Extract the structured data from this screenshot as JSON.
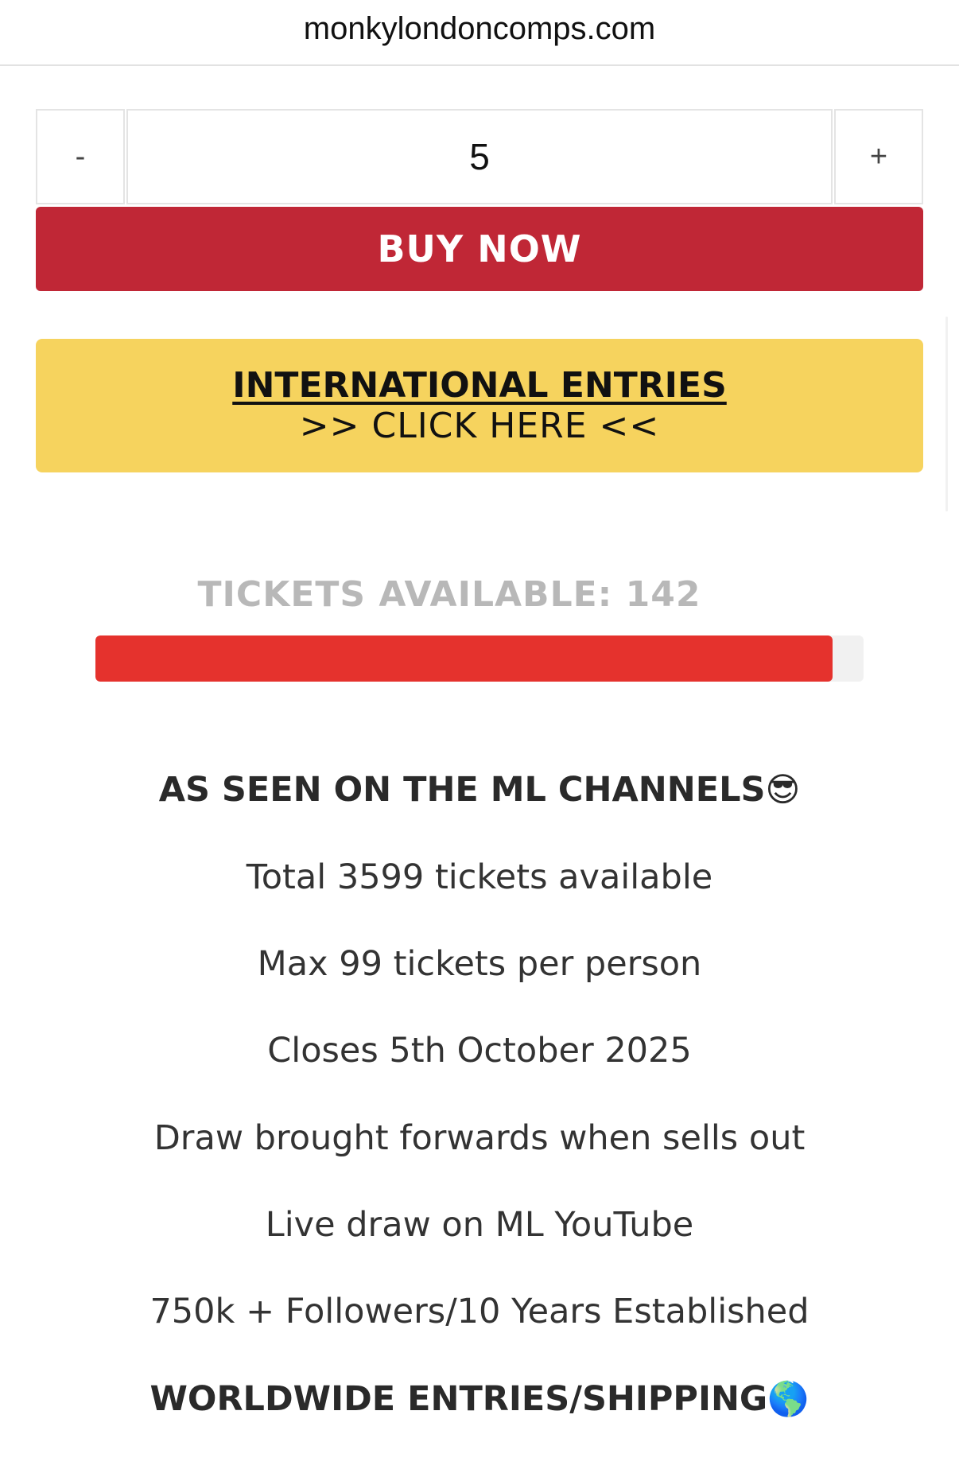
{
  "browser": {
    "url": "monkylondoncomps.com"
  },
  "stepper": {
    "minus_label": "-",
    "plus_label": "+",
    "quantity": "5"
  },
  "buy": {
    "label": "BUY NOW"
  },
  "international": {
    "title": "INTERNATIONAL ENTRIES",
    "subtitle": ">> CLICK HERE <<"
  },
  "tickets": {
    "label": "TICKETS AVAILABLE: 142",
    "progress_fraction": 0.96
  },
  "info": {
    "headline": "AS SEEN ON THE ML CHANNELS",
    "headline_emoji": "😎",
    "lines": [
      "Total 3599 tickets available",
      "Max 99 tickets per person",
      "Closes 5th October 2025",
      "Draw brought forwards when sells out",
      "Live draw on ML YouTube",
      "750k + Followers/10 Years Established"
    ],
    "footer": "WORLDWIDE ENTRIES/SHIPPING",
    "footer_emoji": "🌎"
  },
  "colors": {
    "buy_button": "#c02736",
    "intl_banner": "#f6d35e",
    "progress_fill": "#e5322d",
    "progress_track": "#f1f1f1",
    "tickets_label": "#b8b8b8"
  }
}
